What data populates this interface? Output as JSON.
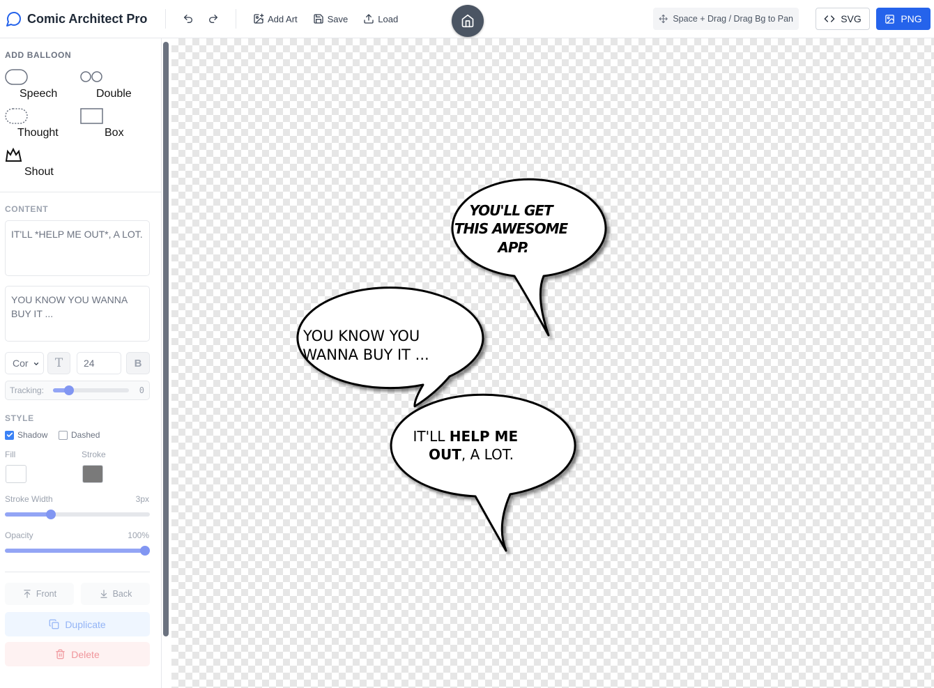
{
  "app": {
    "title": "Comic Architect Pro"
  },
  "toolbar": {
    "add_art": "Add Art",
    "save": "Save",
    "load": "Load",
    "pan_hint": "Space + Drag / Drag Bg to Pan",
    "export_svg": "SVG",
    "export_png": "PNG"
  },
  "sidebar": {
    "add_balloon_title": "ADD BALLOON",
    "shapes": [
      {
        "label": "Speech",
        "icon": "speech-balloon-icon"
      },
      {
        "label": "Double",
        "icon": "double-balloon-icon"
      },
      {
        "label": "Thought",
        "icon": "thought-balloon-icon"
      },
      {
        "label": "Box",
        "icon": "box-balloon-icon"
      },
      {
        "label": "Shout",
        "icon": "shout-balloon-icon"
      }
    ],
    "content_title": "CONTENT",
    "content_texts": [
      "IT'LL *HELP ME OUT*, A LOT.",
      "YOU KNOW YOU WANNA BUY IT ..."
    ],
    "font_select": "Cor",
    "font_size": "24",
    "tracking_label": "Tracking:",
    "tracking_value": "0",
    "style_title": "STYLE",
    "shadow_label": "Shadow",
    "shadow_checked": true,
    "dashed_label": "Dashed",
    "dashed_checked": false,
    "fill_label": "Fill",
    "fill_color": "#ffffff",
    "stroke_label": "Stroke",
    "stroke_color": "#7a7a7a",
    "stroke_width_label": "Stroke Width",
    "stroke_width_value": "3px",
    "opacity_label": "Opacity",
    "opacity_value": "100%",
    "front_label": "Front",
    "back_label": "Back",
    "duplicate_label": "Duplicate",
    "delete_label": "Delete"
  },
  "balloons": [
    {
      "lines": [
        "YOU'LL GET",
        "THIS AWESOME",
        "APP."
      ]
    },
    {
      "lines": [
        "YOU KNOW YOU",
        "WANNA BUY IT ..."
      ]
    },
    {
      "line1_normal": "IT'LL ",
      "line1_bold": "HELP ME",
      "line2_bold": "OUT",
      "line2_normal": ", A LOT."
    }
  ],
  "colors": {
    "accent": "#2563eb",
    "home_button": "#4b5563"
  }
}
